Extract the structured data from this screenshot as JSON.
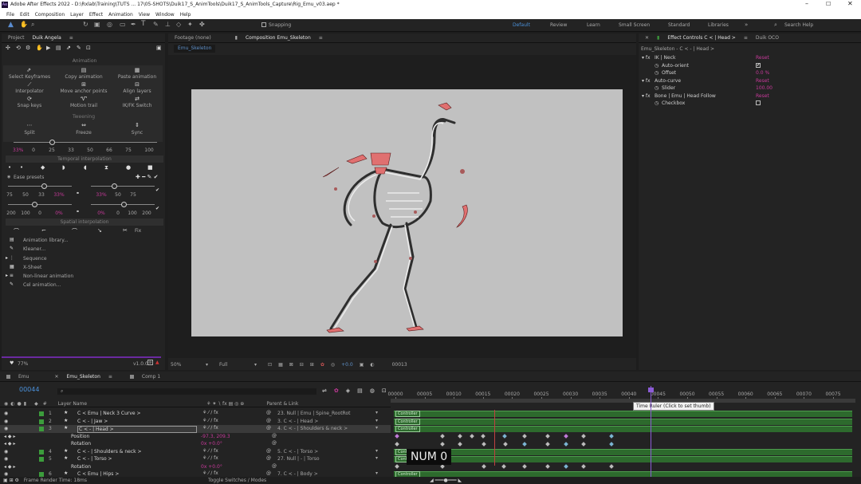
{
  "window": {
    "title": "Adobe After Effects 2022 - D:\\Rxlab\\Training\\TUTS ... 17\\05-SHOTS\\Duik17_S_AnimTools\\Duik17_S_AnimTools_Capture\\Rig_Emu_v03.aep *"
  },
  "menu": [
    "File",
    "Edit",
    "Composition",
    "Layer",
    "Effect",
    "Animation",
    "View",
    "Window",
    "Help"
  ],
  "toolbar": {
    "snapping": "Snapping",
    "workspaces": [
      "Default",
      "Review",
      "Learn",
      "Small Screen",
      "Standard",
      "Libraries"
    ],
    "search_placeholder": "Search Help"
  },
  "left_tabs": [
    "Project",
    "Duik Angela"
  ],
  "duik": {
    "section_animation": "Animation",
    "tools_row1": [
      "Select Keyframes",
      "Copy animation",
      "Paste animation"
    ],
    "tools_row2": [
      "Interpolator",
      "Move anchor points",
      "Align layers"
    ],
    "tools_row3": [
      "Snap keys",
      "Motion trail",
      "IK/FK Switch"
    ],
    "section_tweening": "Tweening",
    "tween_tools": [
      "Split",
      "Freeze",
      "Sync"
    ],
    "slider_pct": "33%",
    "slider_ticks": [
      "0",
      "25",
      "33",
      "50",
      "66",
      "75",
      "100"
    ],
    "section_temporal": "Temporal interpolation",
    "ease_presets": "Ease presets",
    "ease_row1": [
      "75",
      "50",
      "33",
      "33%",
      "33%",
      "50",
      "75"
    ],
    "ease_row2": [
      "200",
      "100",
      "0",
      "0%",
      "0%",
      "0",
      "100",
      "200"
    ],
    "section_spatial": "Spatial interpolation",
    "fix_label": "Fix",
    "list": [
      "Animation library...",
      "Kleaner...",
      "Sequence",
      "X-Sheet",
      "Non-linear animation",
      "Cel animation..."
    ],
    "zoom": "77%",
    "version": "v1.0.0"
  },
  "viewer": {
    "tabs": [
      "Footage (none)",
      "Composition Emu_Skeleton"
    ],
    "crumb": "Emu_Skeleton",
    "magnification": "50%",
    "resolution": "Full",
    "plus_value": "+0.0",
    "timecode": "00013"
  },
  "effect_controls": {
    "tabs": [
      "Effect Controls C < | Head >",
      "Duik OCO"
    ],
    "layer": "Emu_Skeleton - C < - | Head >",
    "reset": "Reset",
    "rows": [
      {
        "name": "IK | Neck",
        "level": 0,
        "value": "Reset"
      },
      {
        "name": "Auto-orient",
        "level": 1,
        "value": "checkbox-on"
      },
      {
        "name": "Offset",
        "level": 1,
        "value": "0.0 %"
      },
      {
        "name": "Auto-curve",
        "level": 0,
        "value": "Reset"
      },
      {
        "name": "Slider",
        "level": 1,
        "value": "100.00"
      },
      {
        "name": "Bone | Emu | Head Follow",
        "level": 0,
        "value": "Reset"
      },
      {
        "name": "Checkbox",
        "level": 1,
        "value": "checkbox-off"
      }
    ]
  },
  "timeline": {
    "tabs": [
      "Emu",
      "Emu_Skeleton",
      "Comp 1"
    ],
    "current_time": "00044",
    "search_placeholder": "",
    "ruler": [
      "00000",
      "00005",
      "00010",
      "00015",
      "00020",
      "00025",
      "00030",
      "00035",
      "00040",
      "00045",
      "00050",
      "00055",
      "00060",
      "00065",
      "00070",
      "00075"
    ],
    "tooltip": "Time Ruler (Click to set thumb)",
    "col_layer": "Layer Name",
    "col_parent": "Parent & Link",
    "footer_left": "Frame Render Time: 18ms",
    "footer_mid": "Toggle Switches / Modes",
    "overlay": "NUM 0",
    "layers": [
      {
        "num": "1",
        "name": "C < Emu | Neck 3 Curve >",
        "parent": "23. Null | Emu | Spine_RootRot",
        "bar": "Controller"
      },
      {
        "num": "2",
        "name": "C < - | Jaw >",
        "parent": "3. C < - | Head >",
        "bar": "Controller"
      },
      {
        "num": "3",
        "name": "C < - | Head >",
        "parent": "4. C < - | Shoulders & neck >",
        "bar": "Controller"
      },
      {
        "num": "",
        "name": "Position",
        "parent": "",
        "bar": ""
      },
      {
        "num": "",
        "name": "Rotation",
        "parent": "",
        "bar": ""
      },
      {
        "num": "4",
        "name": "C < - | Shoulders & neck >",
        "parent": "5. C < - | Torso >",
        "bar": "Controller"
      },
      {
        "num": "5",
        "name": "C < - | Torso >",
        "parent": "27. Null | - | Torso",
        "bar": "Controller"
      },
      {
        "num": "",
        "name": "Rotation",
        "parent": "",
        "bar": ""
      },
      {
        "num": "6",
        "name": "C < Emu | Hips >",
        "parent": "7. C < - | Body >",
        "bar": "Controller"
      }
    ],
    "position_value": "-97.3, 209.3",
    "rotation_value": "0x +0.0°",
    "rotation_value2": "0x +0.0°"
  },
  "colors": {
    "accent": "#c7399a",
    "layer_green": "#3c9d3c",
    "viewer_bg": "#c1c1c1",
    "selection": "#2c5f8a"
  }
}
